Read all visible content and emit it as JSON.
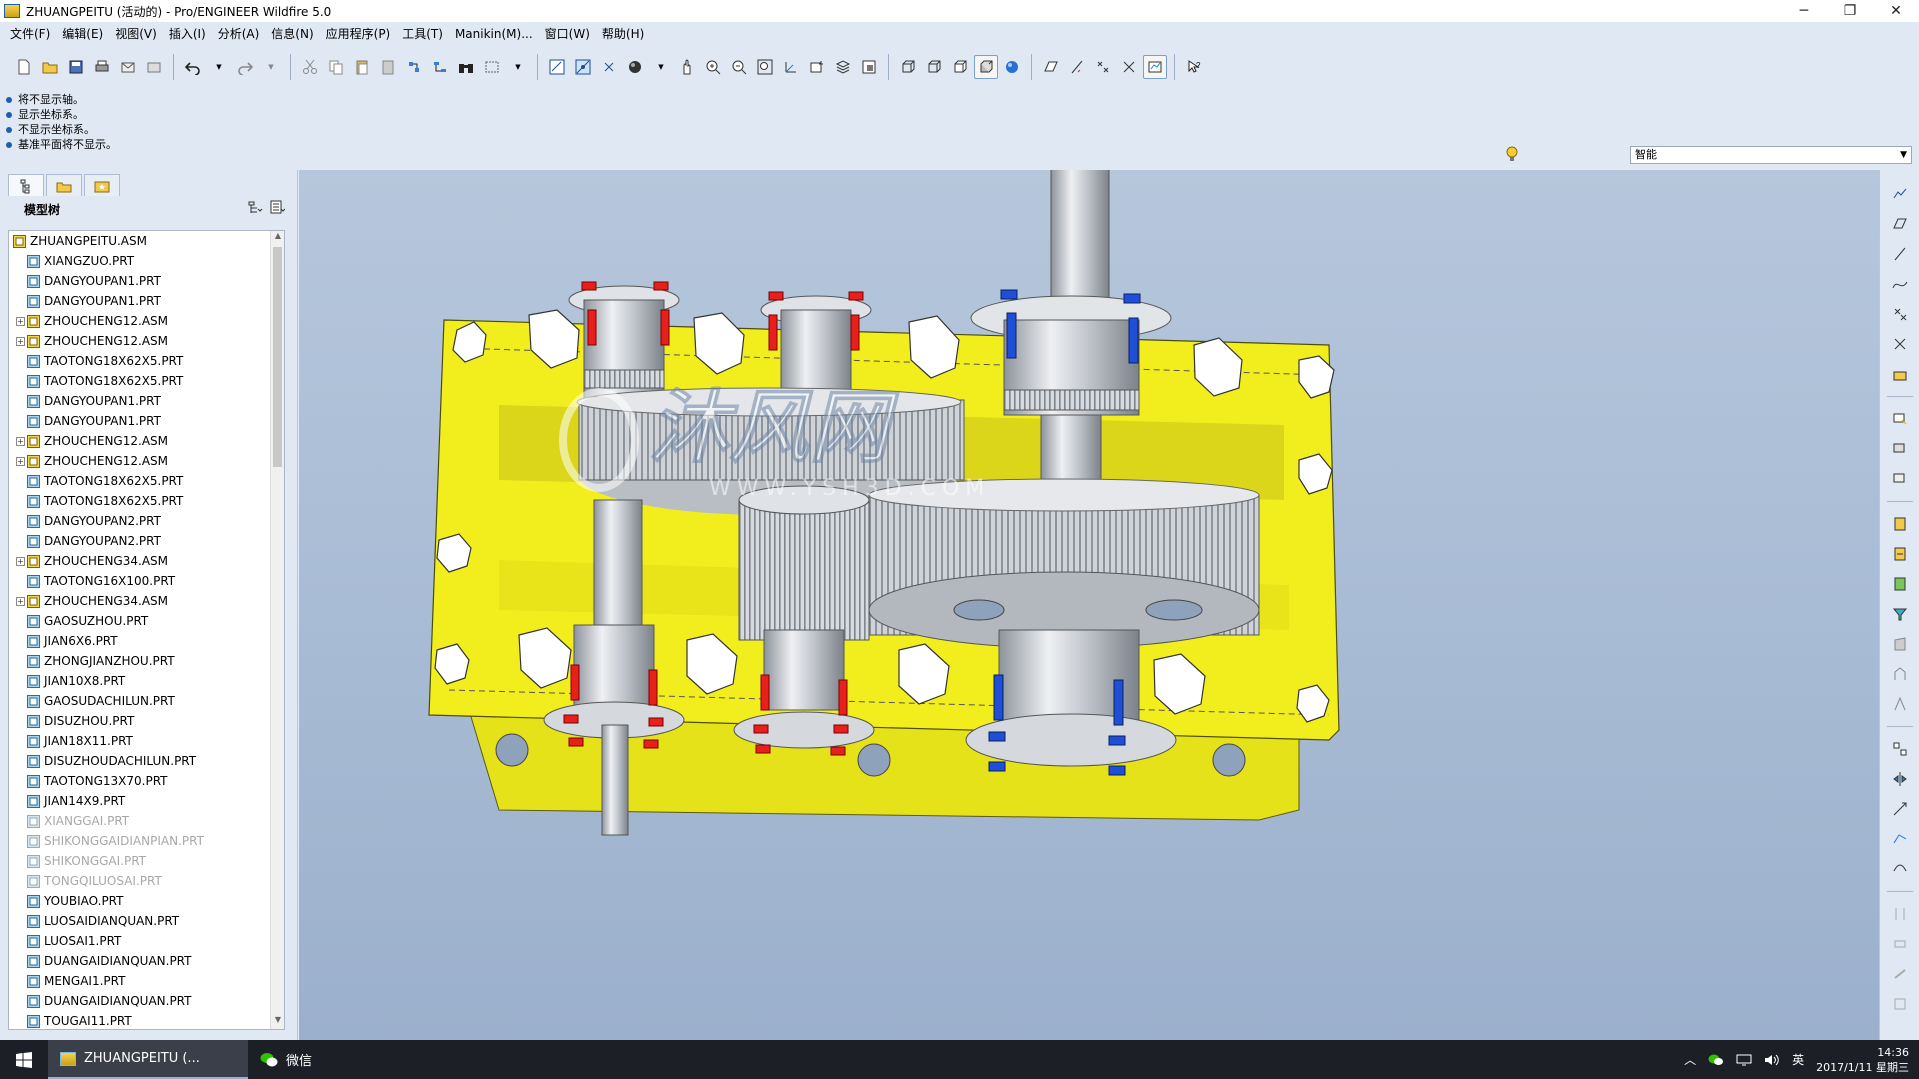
{
  "window": {
    "title": "ZHUANGPEITU (活动的) - Pro/ENGINEER Wildfire 5.0",
    "minimize": "─",
    "restore": "❐",
    "close": "✕"
  },
  "menu": [
    "文件(F)",
    "编辑(E)",
    "视图(V)",
    "插入(I)",
    "分析(A)",
    "信息(N)",
    "应用程序(P)",
    "工具(T)",
    "Manikin(M)...",
    "窗口(W)",
    "帮助(H)"
  ],
  "messages": [
    "将不显示轴。",
    "显示坐标系。",
    "不显示坐标系。",
    "基准平面将不显示。"
  ],
  "smart_filter": "智能",
  "panel": {
    "header": "模型树"
  },
  "tree": [
    {
      "label": "ZHUANGPEITU.ASM",
      "type": "asm",
      "root": true
    },
    {
      "label": "XIANGZUO.PRT",
      "type": "prt"
    },
    {
      "label": "DANGYOUPAN1.PRT",
      "type": "prt"
    },
    {
      "label": "DANGYOUPAN1.PRT",
      "type": "prt"
    },
    {
      "label": "ZHOUCHENG12.ASM",
      "type": "asm",
      "expand": true
    },
    {
      "label": "ZHOUCHENG12.ASM",
      "type": "asm",
      "expand": true
    },
    {
      "label": "TAOTONG18X62X5.PRT",
      "type": "prt"
    },
    {
      "label": "TAOTONG18X62X5.PRT",
      "type": "prt"
    },
    {
      "label": "DANGYOUPAN1.PRT",
      "type": "prt"
    },
    {
      "label": "DANGYOUPAN1.PRT",
      "type": "prt"
    },
    {
      "label": "ZHOUCHENG12.ASM",
      "type": "asm",
      "expand": true
    },
    {
      "label": "ZHOUCHENG12.ASM",
      "type": "asm",
      "expand": true
    },
    {
      "label": "TAOTONG18X62X5.PRT",
      "type": "prt"
    },
    {
      "label": "TAOTONG18X62X5.PRT",
      "type": "prt"
    },
    {
      "label": "DANGYOUPAN2.PRT",
      "type": "prt"
    },
    {
      "label": "DANGYOUPAN2.PRT",
      "type": "prt"
    },
    {
      "label": "ZHOUCHENG34.ASM",
      "type": "asm",
      "expand": true
    },
    {
      "label": "TAOTONG16X100.PRT",
      "type": "prt"
    },
    {
      "label": "ZHOUCHENG34.ASM",
      "type": "asm",
      "expand": true
    },
    {
      "label": "GAOSUZHOU.PRT",
      "type": "prt"
    },
    {
      "label": "JIAN6X6.PRT",
      "type": "prt"
    },
    {
      "label": "ZHONGJIANZHOU.PRT",
      "type": "prt"
    },
    {
      "label": "JIAN10X8.PRT",
      "type": "prt"
    },
    {
      "label": "GAOSUDACHILUN.PRT",
      "type": "prt"
    },
    {
      "label": "DISUZHOU.PRT",
      "type": "prt"
    },
    {
      "label": "JIAN18X11.PRT",
      "type": "prt"
    },
    {
      "label": "DISUZHOUDACHILUN.PRT",
      "type": "prt"
    },
    {
      "label": "TAOTONG13X70.PRT",
      "type": "prt"
    },
    {
      "label": "JIAN14X9.PRT",
      "type": "prt"
    },
    {
      "label": "XIANGGAI.PRT",
      "type": "prt",
      "dim": true
    },
    {
      "label": "SHIKONGGAIDIANPIAN.PRT",
      "type": "prt",
      "dim": true
    },
    {
      "label": "SHIKONGGAI.PRT",
      "type": "prt",
      "dim": true
    },
    {
      "label": "TONGQILUOSAI.PRT",
      "type": "prt",
      "dim": true
    },
    {
      "label": "YOUBIAO.PRT",
      "type": "prt"
    },
    {
      "label": "LUOSAIDIANQUAN.PRT",
      "type": "prt"
    },
    {
      "label": "LUOSAI1.PRT",
      "type": "prt"
    },
    {
      "label": "DUANGAIDIANQUAN.PRT",
      "type": "prt"
    },
    {
      "label": "MENGAI1.PRT",
      "type": "prt"
    },
    {
      "label": "DUANGAIDIANQUAN.PRT",
      "type": "prt"
    },
    {
      "label": "TOUGAI11.PRT",
      "type": "prt"
    }
  ],
  "watermark": {
    "main": "沐风网",
    "url": "WWW.YSH3D.COM"
  },
  "taskbar": {
    "app1": "ZHUANGPEITU (...",
    "app2": "微信",
    "ime": "英",
    "time": "14:36",
    "date": "2017/1/11 星期三"
  },
  "colors": {
    "housing": "#f2ee1e",
    "bolt_red": "#e8201c",
    "bolt_blue": "#1f4fd6",
    "metal": "#c9cdd3"
  }
}
